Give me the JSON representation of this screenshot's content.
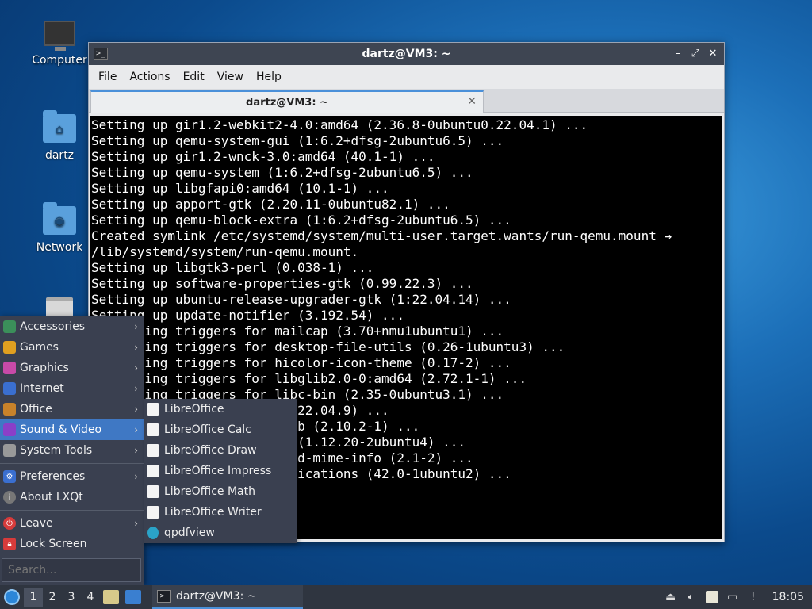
{
  "desktop": {
    "icons": [
      {
        "label": "Computer",
        "icon": "computer-icon"
      },
      {
        "label": "dartz",
        "icon": "home-folder-icon"
      },
      {
        "label": "Network",
        "icon": "network-folder-icon"
      },
      {
        "label": "",
        "icon": "trash-icon"
      }
    ]
  },
  "window": {
    "title": "dartz@VM3: ~",
    "menu": [
      "File",
      "Actions",
      "Edit",
      "View",
      "Help"
    ],
    "tab_label": "dartz@VM3: ~",
    "terminal_lines": [
      "Setting up gir1.2-webkit2-4.0:amd64 (2.36.8-0ubuntu0.22.04.1) ...",
      "Setting up qemu-system-gui (1:6.2+dfsg-2ubuntu6.5) ...",
      "Setting up gir1.2-wnck-3.0:amd64 (40.1-1) ...",
      "Setting up qemu-system (1:6.2+dfsg-2ubuntu6.5) ...",
      "Setting up libgfapi0:amd64 (10.1-1) ...",
      "Setting up apport-gtk (2.20.11-0ubuntu82.1) ...",
      "Setting up qemu-block-extra (1:6.2+dfsg-2ubuntu6.5) ...",
      "Created symlink /etc/systemd/system/multi-user.target.wants/run-qemu.mount →",
      "/lib/systemd/system/run-qemu.mount.",
      "Setting up libgtk3-perl (0.038-1) ...",
      "Setting up software-properties-gtk (0.99.22.3) ...",
      "Setting up ubuntu-release-upgrader-gtk (1:22.04.14) ...",
      "Setting up update-notifier (3.192.54) ...",
      "Processing triggers for mailcap (3.70+nmu1ubuntu1) ...",
      "Processing triggers for desktop-file-utils (0.26-1ubuntu3) ...",
      "Processing triggers for hicolor-icon-theme (0.17-2) ...",
      "Processing triggers for libglib2.0-0:amd64 (2.72.1-1) ...",
      "Processing triggers for libc-bin (2.35-0ubuntu3.1) ...",
      "Processing triggers for (1:22.04.9) ...",
      "Processing triggers for n-db (2.10.2-1) ...",
      "Processing triggers for us (1.12.20-2ubuntu4) ...",
      "Processing triggers for ared-mime-info (2.1-2) ...",
      "Processing triggers for pplications (42.0-1ubuntu2) ..."
    ]
  },
  "app_menu": {
    "categories": [
      {
        "label": "Accessories",
        "icon": "accessories-icon",
        "color": "#3b8f5a"
      },
      {
        "label": "Games",
        "icon": "games-icon",
        "color": "#e0a020"
      },
      {
        "label": "Graphics",
        "icon": "graphics-icon",
        "color": "#c84aa8"
      },
      {
        "label": "Internet",
        "icon": "internet-icon",
        "color": "#3a6fd0"
      },
      {
        "label": "Office",
        "icon": "office-icon",
        "color": "#c8822a"
      },
      {
        "label": "Sound & Video",
        "icon": "sound-video-icon",
        "color": "#8a3fc8"
      },
      {
        "label": "System Tools",
        "icon": "system-tools-icon",
        "color": "#999999"
      }
    ],
    "preferences": "Preferences",
    "about": "About LXQt",
    "leave": "Leave",
    "lock": "Lock Screen",
    "search_placeholder": "Search..."
  },
  "office_submenu": [
    {
      "label": "LibreOffice",
      "icon": "libreoffice-icon"
    },
    {
      "label": "LibreOffice Calc",
      "icon": "libreoffice-calc-icon"
    },
    {
      "label": "LibreOffice Draw",
      "icon": "libreoffice-draw-icon"
    },
    {
      "label": "LibreOffice Impress",
      "icon": "libreoffice-impress-icon"
    },
    {
      "label": "LibreOffice Math",
      "icon": "libreoffice-math-icon"
    },
    {
      "label": "LibreOffice Writer",
      "icon": "libreoffice-writer-icon"
    },
    {
      "label": "qpdfview",
      "icon": "qpdfview-icon"
    }
  ],
  "taskbar": {
    "desktops": [
      "1",
      "2",
      "3",
      "4"
    ],
    "task_label": "dartz@VM3: ~",
    "clock": "18:05"
  }
}
